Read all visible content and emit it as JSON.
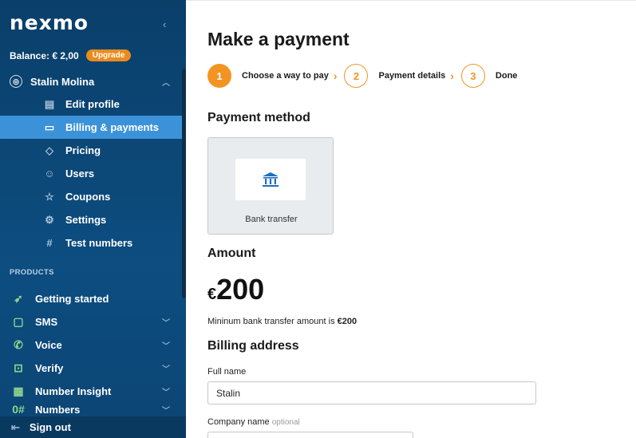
{
  "sidebar": {
    "logo": "nexmo",
    "balance": "Balance: € 2,00",
    "upgrade": "Upgrade",
    "user_name": "Stalin Molina",
    "account_items": [
      {
        "label": "Edit profile",
        "icon": "id-card-icon"
      },
      {
        "label": "Billing & payments",
        "icon": "credit-card-icon"
      },
      {
        "label": "Pricing",
        "icon": "tag-icon"
      },
      {
        "label": "Users",
        "icon": "users-icon"
      },
      {
        "label": "Coupons",
        "icon": "star-icon"
      },
      {
        "label": "Settings",
        "icon": "gear-icon"
      },
      {
        "label": "Test numbers",
        "icon": "hash-icon"
      }
    ],
    "products_heading": "PRODUCTS",
    "product_items": [
      {
        "label": "Getting started",
        "icon": "rocket-icon"
      },
      {
        "label": "SMS",
        "icon": "message-icon"
      },
      {
        "label": "Voice",
        "icon": "phone-icon"
      },
      {
        "label": "Verify",
        "icon": "lock-icon"
      },
      {
        "label": "Number Insight",
        "icon": "document-search-icon"
      },
      {
        "label": "Numbers",
        "icon": "numbers-icon"
      }
    ],
    "sign_out": "Sign out"
  },
  "main": {
    "title": "Make a payment",
    "steps": [
      {
        "num": "1",
        "label": "Choose a way to pay"
      },
      {
        "num": "2",
        "label": "Payment details"
      },
      {
        "num": "3",
        "label": "Done"
      }
    ],
    "payment_method_heading": "Payment method",
    "method_label": "Bank transfer",
    "amount_heading": "Amount",
    "amount_currency": "€",
    "amount_value": "200",
    "note_prefix": "Mininum bank transfer amount is ",
    "note_amount": "€200",
    "billing_heading": "Billing address",
    "full_name_label": "Full name",
    "full_name_value": "Stalin",
    "company_label": "Company name",
    "company_optional": "optional"
  },
  "colors": {
    "accent": "#f39422",
    "sidebar": "#0d4d80",
    "active": "#3c92d8"
  }
}
